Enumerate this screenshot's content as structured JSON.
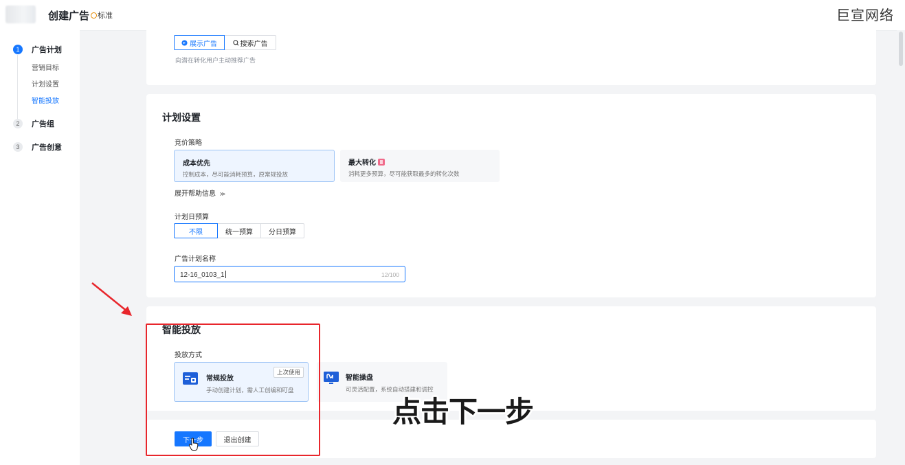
{
  "header": {
    "title": "创建广告",
    "badge": "标准",
    "watermark": "巨宣网络"
  },
  "sidebar": {
    "steps": [
      {
        "num": "1",
        "label": "广告计划",
        "active": true
      },
      {
        "num": "2",
        "label": "广告组",
        "active": false
      },
      {
        "num": "3",
        "label": "广告创意",
        "active": false
      }
    ],
    "substeps": [
      {
        "label": "营销目标"
      },
      {
        "label": "计划设置"
      },
      {
        "label": "智能投放",
        "active": true
      }
    ]
  },
  "ad_type": {
    "options": [
      "展示广告",
      "搜索广告"
    ],
    "selected": "展示广告",
    "hint": "向潜在转化用户主动推荐广告"
  },
  "plan_settings": {
    "title": "计划设置",
    "bid_label": "竞价策略",
    "bid_options": [
      {
        "title": "成本优先",
        "desc": "控制成本，尽可能消耗预算，原常规投放",
        "selected": true
      },
      {
        "title": "最大转化",
        "desc": "消耗更多预算，尽可能获取最多的转化次数",
        "selected": false
      }
    ],
    "expand_help": "展开帮助信息",
    "budget_label": "计划日预算",
    "budget_options": [
      "不限",
      "统一预算",
      "分日预算"
    ],
    "budget_selected": "不限",
    "name_label": "广告计划名称",
    "name_value": "12-16_0103_1",
    "name_count": "12/100"
  },
  "smart_delivery": {
    "title": "智能投放",
    "mode_label": "投放方式",
    "modes": [
      {
        "title": "常规投放",
        "desc": "手动创建计划，需人工创编和盯盘",
        "tag": "上次使用",
        "selected": true
      },
      {
        "title": "智能操盘",
        "desc": "可灵活配置，系统自动搭建和调控",
        "selected": false
      }
    ]
  },
  "actions": {
    "next": "下一步",
    "exit": "退出创建"
  },
  "overlay": {
    "caption": "点击下一步"
  },
  "colors": {
    "primary": "#1677ff",
    "annotation_red": "#e8262c"
  }
}
